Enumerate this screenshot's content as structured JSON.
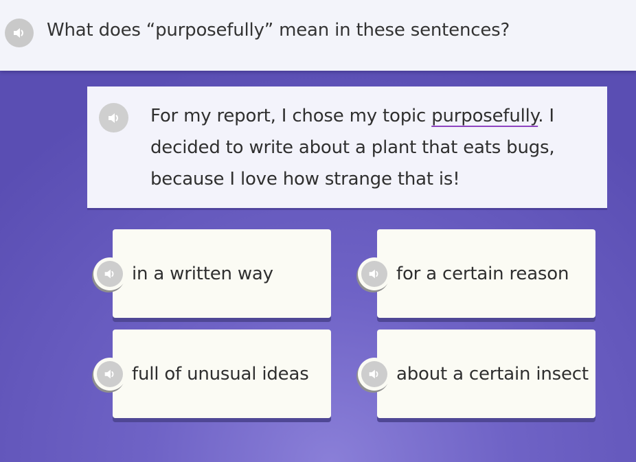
{
  "question": {
    "text": "What does “purposefully” mean in these sentences?",
    "speaker_icon": "speaker-icon"
  },
  "passage": {
    "before": "For my report, I chose my topic ",
    "keyword": "purposefully",
    "after": ". I decided to write about a plant that eats bugs, because I love how strange that is!",
    "speaker_icon": "speaker-icon"
  },
  "choices": [
    {
      "label": "in a written way"
    },
    {
      "label": "for a certain reason"
    },
    {
      "label": "full of unusual ideas"
    },
    {
      "label": "about a certain insect"
    }
  ],
  "colors": {
    "background": "#6f63c6",
    "card": "#fbfbf4",
    "keyword_underline": "#8e44c0",
    "speaker": "#c9c9c9"
  }
}
